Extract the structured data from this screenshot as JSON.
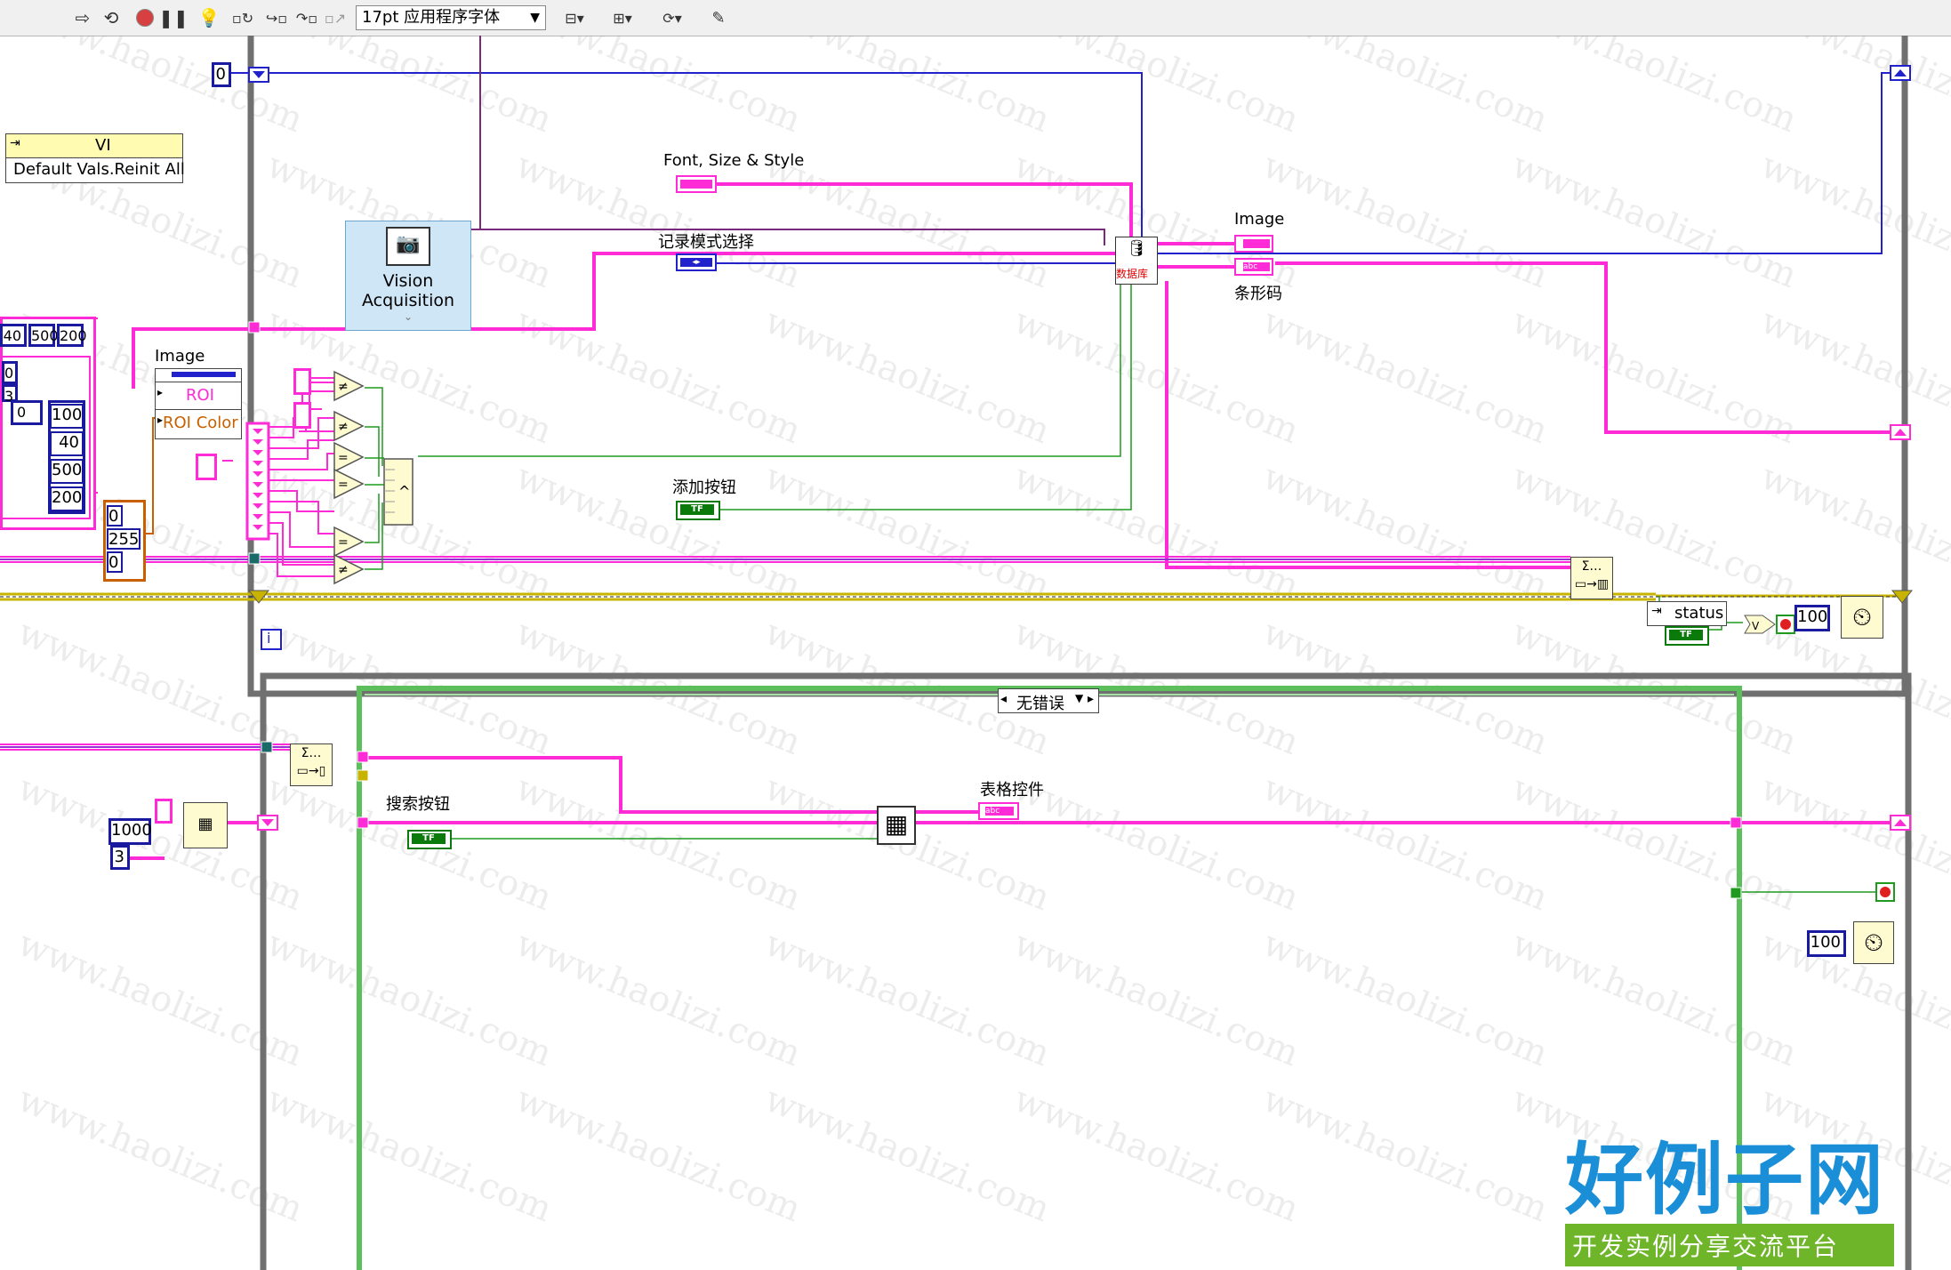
{
  "toolbar": {
    "font": "17pt 应用程序字体"
  },
  "block_diagram": {
    "constants": {
      "zero_top": "0",
      "list": [
        "0",
        "3"
      ],
      "array_index": "0",
      "array_header": [
        "40",
        "500",
        "200"
      ],
      "array_values": [
        "100",
        "40",
        "500",
        "200"
      ],
      "color_values": [
        "0",
        "255",
        "0"
      ],
      "wait_top": "100",
      "wait_bottom": "100",
      "timeout": "1000",
      "count": "3"
    },
    "property_node": {
      "class": "VI",
      "property": "Default Vals.Reinit All"
    },
    "vision_acquisition": {
      "line1": "Vision",
      "line2": "Acquisition"
    },
    "image_node": {
      "title": "Image",
      "prop1": "ROI",
      "prop2": "ROI Color"
    },
    "labels": {
      "font_style": "Font, Size & Style",
      "record_mode": "记录模式选择",
      "add_button": "添加按钮",
      "image_out": "Image",
      "barcode": "条形码",
      "status": "status",
      "search_button": "搜索按钮",
      "table_control": "表格控件",
      "case_selector": "无错误",
      "subvi": "数据库",
      "iteration": "i"
    }
  },
  "branding": {
    "logo_main": "好例子网",
    "logo_sub": "开发实例分享交流平台",
    "watermark": "www.haolizi.com"
  },
  "colors": {
    "pink_wire": "#ff2bd6",
    "blue_wire": "#2222cc",
    "green_wire": "#1f9a1f",
    "error_wire": "#c8b400",
    "loop_frame": "#707070"
  }
}
